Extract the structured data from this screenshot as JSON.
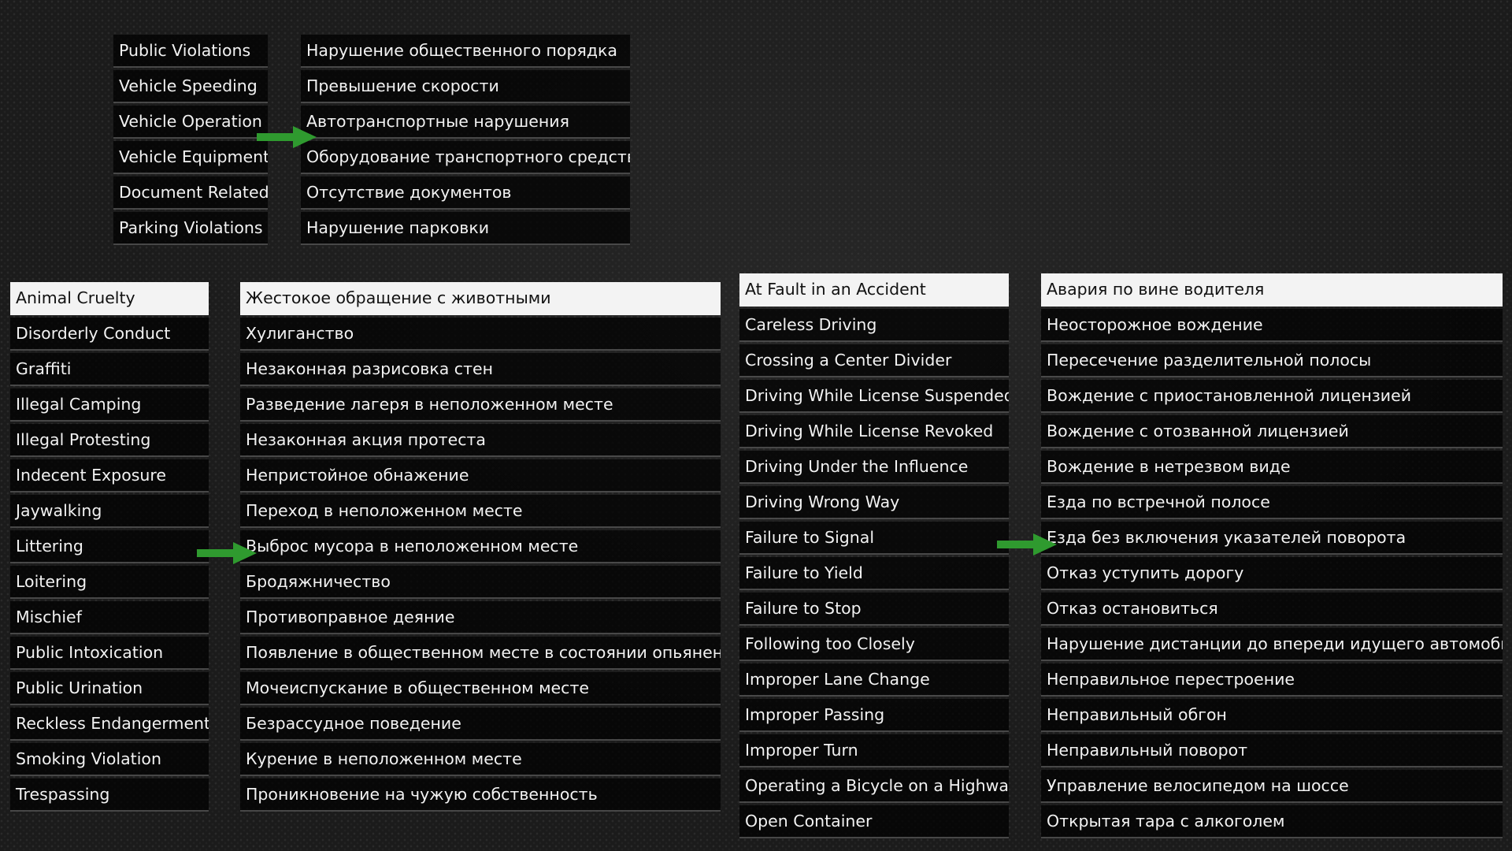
{
  "menu_top_en": {
    "items": [
      {
        "label": "Public Violations"
      },
      {
        "label": "Vehicle Speeding"
      },
      {
        "label": "Vehicle Operation"
      },
      {
        "label": "Vehicle Equipment"
      },
      {
        "label": "Document Related"
      },
      {
        "label": "Parking Violations"
      }
    ]
  },
  "menu_top_ru": {
    "items": [
      {
        "label": "Нарушение общественного порядка"
      },
      {
        "label": "Превышение скорости"
      },
      {
        "label": "Автотранспортные нарушения"
      },
      {
        "label": "Оборудование транспортного средства"
      },
      {
        "label": "Отсутствие документов"
      },
      {
        "label": "Нарушение парковки"
      }
    ]
  },
  "menu_public_en": {
    "selected_index": 0,
    "items": [
      {
        "label": "Animal Cruelty"
      },
      {
        "label": "Disorderly Conduct"
      },
      {
        "label": "Graffiti"
      },
      {
        "label": "Illegal Camping"
      },
      {
        "label": "Illegal Protesting"
      },
      {
        "label": "Indecent Exposure"
      },
      {
        "label": "Jaywalking"
      },
      {
        "label": "Littering"
      },
      {
        "label": "Loitering"
      },
      {
        "label": "Mischief"
      },
      {
        "label": "Public Intoxication"
      },
      {
        "label": "Public Urination"
      },
      {
        "label": "Reckless Endangerment"
      },
      {
        "label": "Smoking Violation"
      },
      {
        "label": "Trespassing"
      }
    ]
  },
  "menu_public_ru": {
    "selected_index": 0,
    "items": [
      {
        "label": "Жестокое обращение с животными"
      },
      {
        "label": "Хулиганство"
      },
      {
        "label": "Незаконная разрисовка стен"
      },
      {
        "label": "Разведение лагеря в неположенном месте"
      },
      {
        "label": "Незаконная акция протеста"
      },
      {
        "label": "Непристойное обнажение"
      },
      {
        "label": "Переход в неположенном месте"
      },
      {
        "label": "Выброс мусора в неположенном месте"
      },
      {
        "label": "Бродяжничество"
      },
      {
        "label": "Противоправное деяние"
      },
      {
        "label": "Появление в общественном месте в состоянии опьянения"
      },
      {
        "label": "Мочеиспускание в общественном месте"
      },
      {
        "label": "Безрассудное поведение"
      },
      {
        "label": "Курение в неположенном месте"
      },
      {
        "label": "Проникновение на чужую собственность"
      }
    ]
  },
  "menu_operation_en": {
    "selected_index": 0,
    "items": [
      {
        "label": "At Fault in an Accident"
      },
      {
        "label": "Careless Driving"
      },
      {
        "label": "Crossing a Center Divider"
      },
      {
        "label": "Driving While License Suspended"
      },
      {
        "label": "Driving While License Revoked"
      },
      {
        "label": "Driving Under the Influence"
      },
      {
        "label": "Driving Wrong Way"
      },
      {
        "label": "Failure to Signal"
      },
      {
        "label": "Failure to Yield"
      },
      {
        "label": "Failure to Stop"
      },
      {
        "label": "Following too Closely"
      },
      {
        "label": "Improper Lane Change"
      },
      {
        "label": "Improper Passing"
      },
      {
        "label": "Improper Turn"
      },
      {
        "label": "Operating a Bicycle on a Highway"
      },
      {
        "label": "Open Container"
      }
    ]
  },
  "menu_operation_ru": {
    "selected_index": 0,
    "items": [
      {
        "label": "Авария по вине водителя"
      },
      {
        "label": "Неосторожное вождение"
      },
      {
        "label": "Пересечение разделительной полосы"
      },
      {
        "label": "Вождение с приостановленной лицензией"
      },
      {
        "label": "Вождение с отозванной лицензией"
      },
      {
        "label": "Вождение в нетрезвом виде"
      },
      {
        "label": "Езда по встречной полосе"
      },
      {
        "label": "Езда без включения указателей поворота"
      },
      {
        "label": "Отказ уступить дорогу"
      },
      {
        "label": "Отказ остановиться"
      },
      {
        "label": "Нарушение дистанции до впереди идущего автомобиля"
      },
      {
        "label": "Неправильное перестроение"
      },
      {
        "label": "Неправильный обгон"
      },
      {
        "label": "Неправильный поворот"
      },
      {
        "label": "Управление велосипедом на шоссе"
      },
      {
        "label": "Открытая тара с алкоголем"
      }
    ]
  },
  "colors": {
    "arrow": "#2f9a2f",
    "selected_bg": "#f3f3f3"
  },
  "icons": {
    "arrow": "arrow-right-icon"
  }
}
